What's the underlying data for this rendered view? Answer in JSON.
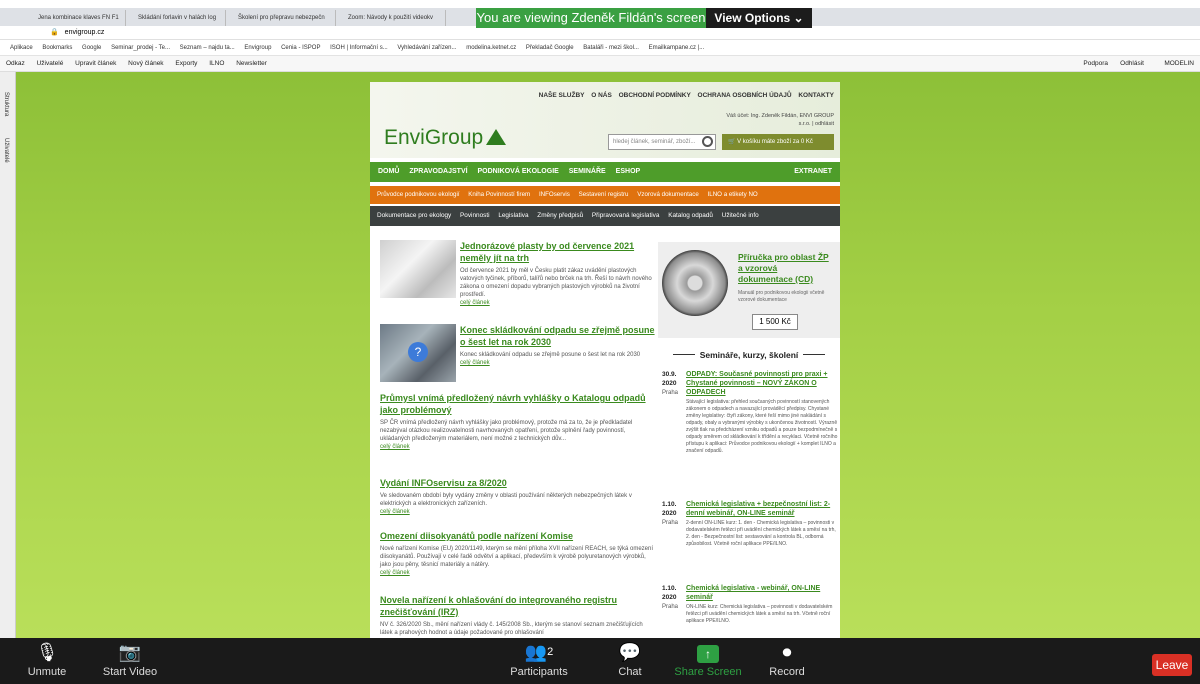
{
  "share": {
    "message": "You are viewing Zdeněk Fildán's screen",
    "view_options": "View Options ⌄"
  },
  "browser": {
    "tabs": [
      "Jena kombinace klaves FN F1",
      "Skládání forlavin v halách log",
      "Školení pro přepravu nebezpečn",
      "Zoom: Návody k použití videokv"
    ],
    "url": "envigroup.cz",
    "bookmarks": [
      "Aplikace",
      "Bookmarks",
      "Google",
      "Seminar_prodej - Te...",
      "Seznam – najdu ta...",
      "Envigroup",
      "Cenia - ISPOP",
      "ISOH | Informační s...",
      "Vyhledávání zařízen...",
      "modelina.ketnet.cz",
      "Překladač Google",
      "Bataláři - mezi škol...",
      "Emailkampane.cz |..."
    ]
  },
  "wpbar": {
    "left": [
      "Odkaz",
      "Uživatelé",
      "Upravit článek",
      "Nový článek",
      "Exporty",
      "ILNO",
      "Newsletter"
    ],
    "right": [
      "Podpora",
      "Odhlásit",
      "MODELIN"
    ]
  },
  "sidebar": {
    "items": [
      "Struktura",
      "Uživatelé"
    ]
  },
  "site": {
    "topnav": [
      "NAŠE SLUŽBY",
      "O NÁS",
      "OBCHODNÍ PODMÍNKY",
      "OCHRANA OSOBNÍCH ÚDAJŮ",
      "KONTAKTY"
    ],
    "logo": "EnviGroup",
    "account": "Váš účet: Ing. Zdeněk Fildán, ENVI GROUP s.r.o. | odhlásit",
    "search_placeholder": "hledej článek, seminář, zboží...",
    "cart": "V košíku máte zboží za 0 Kč",
    "nav1": [
      "DOMŮ",
      "ZPRAVODAJSTVÍ",
      "PODNIKOVÁ EKOLOGIE",
      "SEMINÁŘE",
      "ESHOP"
    ],
    "extranet": "EXTRANET",
    "nav2": [
      "Průvodce podnikovou ekologií",
      "Kniha Povinností firem",
      "INFOservis",
      "Sestavení registru",
      "Vzorová dokumentace",
      "ILNO a etikety NO"
    ],
    "nav3": [
      "Dokumentace pro ekology",
      "Povinnosti",
      "Legislativa",
      "Změny předpisů",
      "Připravovaná legislativa",
      "Katalog odpadů",
      "Užitečné info"
    ],
    "articles": [
      {
        "title": "Jednorázové plasty by od července 2021 neměly jít na trh",
        "desc": "Od července 2021 by měl v Česku platit zákaz uvádění plastových vatových tyčinek, příborů, talířů nebo brček na trh. Řeší to návrh nového zákona o omezení dopadu vybraných plastových výrobků na životní prostředí.",
        "more": "celý článek"
      },
      {
        "title": "Konec skládkování odpadu se zřejmě posune o šest let na rok 2030",
        "desc": "Konec skládkování odpadu se zřejmě posune o šest let na rok 2030",
        "more": "celý článek"
      },
      {
        "title": "Průmysl vnímá předložený návrh vyhlášky o Katalogu odpadů jako problémový",
        "desc": "SP ČR vnímá předložený návrh vyhlášky jako problémový, protože má za to, že je předkladatel nezabýval otázkou realizovatelnosti navrhovaných opatření, protože splnění řady povinností, ukládaných předloženým materiálem, není možné z technických dův...",
        "more": "celý článek"
      },
      {
        "title": "Vydání INFOservisu za 8/2020",
        "desc": "Ve sledovaném období byly vydány změny v oblasti používání některých nebezpečných látek v elektrických a elektronických zařízeních.",
        "more": "celý článek"
      },
      {
        "title": "Omezení diisokyanátů podle nařízení Komise",
        "desc": "Nové nařízení Komise (EU) 2020/1149, kterým se mění příloha XVII nařízení REACH, se týká omezení diisokyanátů. Používají v celé řadě odvětví a aplikací, především k výrobě polyuretanových výrobků, jako jsou pěny, těsnicí materiály a nátěry.",
        "more": "celý článek"
      },
      {
        "title": "Novela nařízení k ohlašování do integrovaného registru znečišťování (IRZ)",
        "desc": "NV č. 326/2020 Sb., mění nařízení vlády č. 145/2008 Sb., kterým se stanoví seznam znečišťujících látek a prahových hodnot a údaje požadované pro ohlašování",
        "more": ""
      }
    ],
    "promo": {
      "title": "Příručka pro oblast ŽP a vzorová dokumentace (CD)",
      "desc": "Manuál pro podnikovou ekologii včetně vzorové dokumentace",
      "price": "1 500 Kč"
    },
    "seminars_heading": "Semináře, kurzy, školení",
    "events": [
      {
        "date": "30.9. 2020",
        "place": "Praha",
        "title": "ODPADY: Současné povinnosti pro praxi + Chystané povinnosti – NOVÝ ZÁKON O ODPADECH",
        "desc": "Stávající legislativa: přehled současných povinností stanovených zákonem o odpadech a navazující prováděcí předpisy. Chystané změny legislativy: čtyři zákony, které řeší mimo jiné nakládání s odpady, obaly a vybranými výrobky s ukončenou životností. Výrazně zvýšit tlak na předcházení vzniku odpadů a pouze bezpodmínečně s odpady směrem od skládkování k třídění a recyklaci. Včetně ročního přístupu k aplikaci: Průvodce podnikovou ekologií + komplet ILNO a značení odpadů."
      },
      {
        "date": "1.10. 2020",
        "place": "Praha",
        "title": "Chemická legislativa + bezpečnostní list: 2-denní webinář, ON-LINE seminář",
        "desc": "2-denní ON-LINE kurz: 1. den - Chemická legislativa – povinnosti v dodavatelském řetězci při uvádění chemických látek a směsí na trh, 2. den - Bezpečnostní list: sestavování a kontrola BL, odborná způsobilost. Včetně roční aplikace PPE/ILNO."
      },
      {
        "date": "1.10. 2020",
        "place": "Praha",
        "title": "Chemická legislativa - webinář, ON-LINE seminář",
        "desc": "ON-LINE kurz: Chemická legislativa – povinnosti v dodavatelském řetězci při uvádění chemických látek a směsí na trh. Včetně roční aplikace PPE/ILNO."
      }
    ]
  },
  "zoom": {
    "unmute": "Unmute",
    "start_video": "Start Video",
    "participants": "Participants",
    "participants_count": "2",
    "chat": "Chat",
    "share": "Share Screen",
    "record": "Record",
    "leave": "Leave"
  }
}
